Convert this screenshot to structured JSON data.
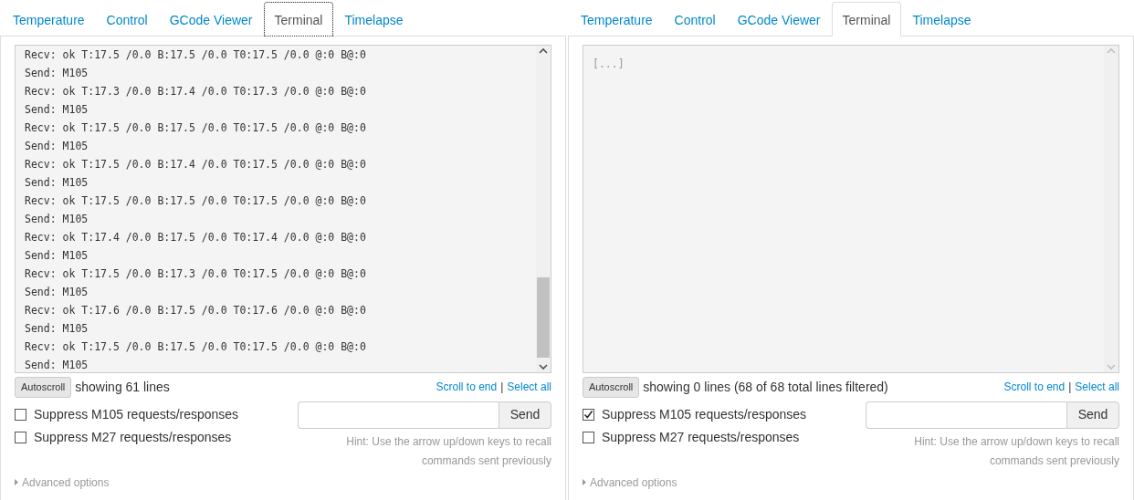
{
  "panels": [
    {
      "tabs": [
        {
          "label": "Temperature",
          "selected": false,
          "focused": false
        },
        {
          "label": "Control",
          "selected": false,
          "focused": false
        },
        {
          "label": "GCode Viewer",
          "selected": false,
          "focused": false
        },
        {
          "label": "Terminal",
          "selected": true,
          "focused": true
        },
        {
          "label": "Timelapse",
          "selected": false,
          "focused": false
        }
      ],
      "terminal": {
        "scrollable": true,
        "lines": [
          {
            "kind": "line",
            "text": "Recv: ok T:17.5 /0.0 B:17.5 /0.0 T0:17.5 /0.0 @:0 B@:0"
          },
          {
            "kind": "line",
            "text": "Send: M105"
          },
          {
            "kind": "line",
            "text": "Recv: ok T:17.3 /0.0 B:17.4 /0.0 T0:17.3 /0.0 @:0 B@:0"
          },
          {
            "kind": "line",
            "text": "Send: M105"
          },
          {
            "kind": "line",
            "text": "Recv: ok T:17.5 /0.0 B:17.5 /0.0 T0:17.5 /0.0 @:0 B@:0"
          },
          {
            "kind": "line",
            "text": "Send: M105"
          },
          {
            "kind": "line",
            "text": "Recv: ok T:17.5 /0.0 B:17.4 /0.0 T0:17.5 /0.0 @:0 B@:0"
          },
          {
            "kind": "line",
            "text": "Send: M105"
          },
          {
            "kind": "line",
            "text": "Recv: ok T:17.5 /0.0 B:17.5 /0.0 T0:17.5 /0.0 @:0 B@:0"
          },
          {
            "kind": "line",
            "text": "Send: M105"
          },
          {
            "kind": "line",
            "text": "Recv: ok T:17.4 /0.0 B:17.5 /0.0 T0:17.4 /0.0 @:0 B@:0"
          },
          {
            "kind": "line",
            "text": "Send: M105"
          },
          {
            "kind": "line",
            "text": "Recv: ok T:17.5 /0.0 B:17.3 /0.0 T0:17.5 /0.0 @:0 B@:0"
          },
          {
            "kind": "line",
            "text": "Send: M105"
          },
          {
            "kind": "line",
            "text": "Recv: ok T:17.6 /0.0 B:17.5 /0.0 T0:17.6 /0.0 @:0 B@:0"
          },
          {
            "kind": "line",
            "text": "Send: M105"
          },
          {
            "kind": "line",
            "text": "Recv: ok T:17.5 /0.0 B:17.5 /0.0 T0:17.5 /0.0 @:0 B@:0"
          },
          {
            "kind": "line",
            "text": "Send: M105"
          }
        ]
      },
      "autoscroll": "Autoscroll",
      "status": "showing 61 lines",
      "scroll_link": "Scroll to end",
      "separator": "|",
      "select_link": "Select all",
      "options": [
        {
          "label": "Suppress M105 requests/responses",
          "checked": false
        },
        {
          "label": "Suppress M27 requests/responses",
          "checked": false
        }
      ],
      "send_button": "Send",
      "hint": "Hint: Use the arrow up/down keys to recall commands sent previously",
      "advanced": "Advanced options"
    },
    {
      "tabs": [
        {
          "label": "Temperature",
          "selected": false,
          "focused": false
        },
        {
          "label": "Control",
          "selected": false,
          "focused": false
        },
        {
          "label": "GCode Viewer",
          "selected": false,
          "focused": false
        },
        {
          "label": "Terminal",
          "selected": true,
          "focused": false
        },
        {
          "label": "Timelapse",
          "selected": false,
          "focused": false
        }
      ],
      "terminal": {
        "scrollable": false,
        "lines": [
          {
            "kind": "omitted",
            "text": "[...]"
          }
        ]
      },
      "autoscroll": "Autoscroll",
      "status": "showing 0 lines (68 of 68 total lines filtered)",
      "scroll_link": "Scroll to end",
      "separator": "|",
      "select_link": "Select all",
      "options": [
        {
          "label": "Suppress M105 requests/responses",
          "checked": true
        },
        {
          "label": "Suppress M27 requests/responses",
          "checked": false
        }
      ],
      "send_button": "Send",
      "hint": "Hint: Use the arrow up/down keys to recall commands sent previously",
      "advanced": "Advanced options"
    }
  ]
}
